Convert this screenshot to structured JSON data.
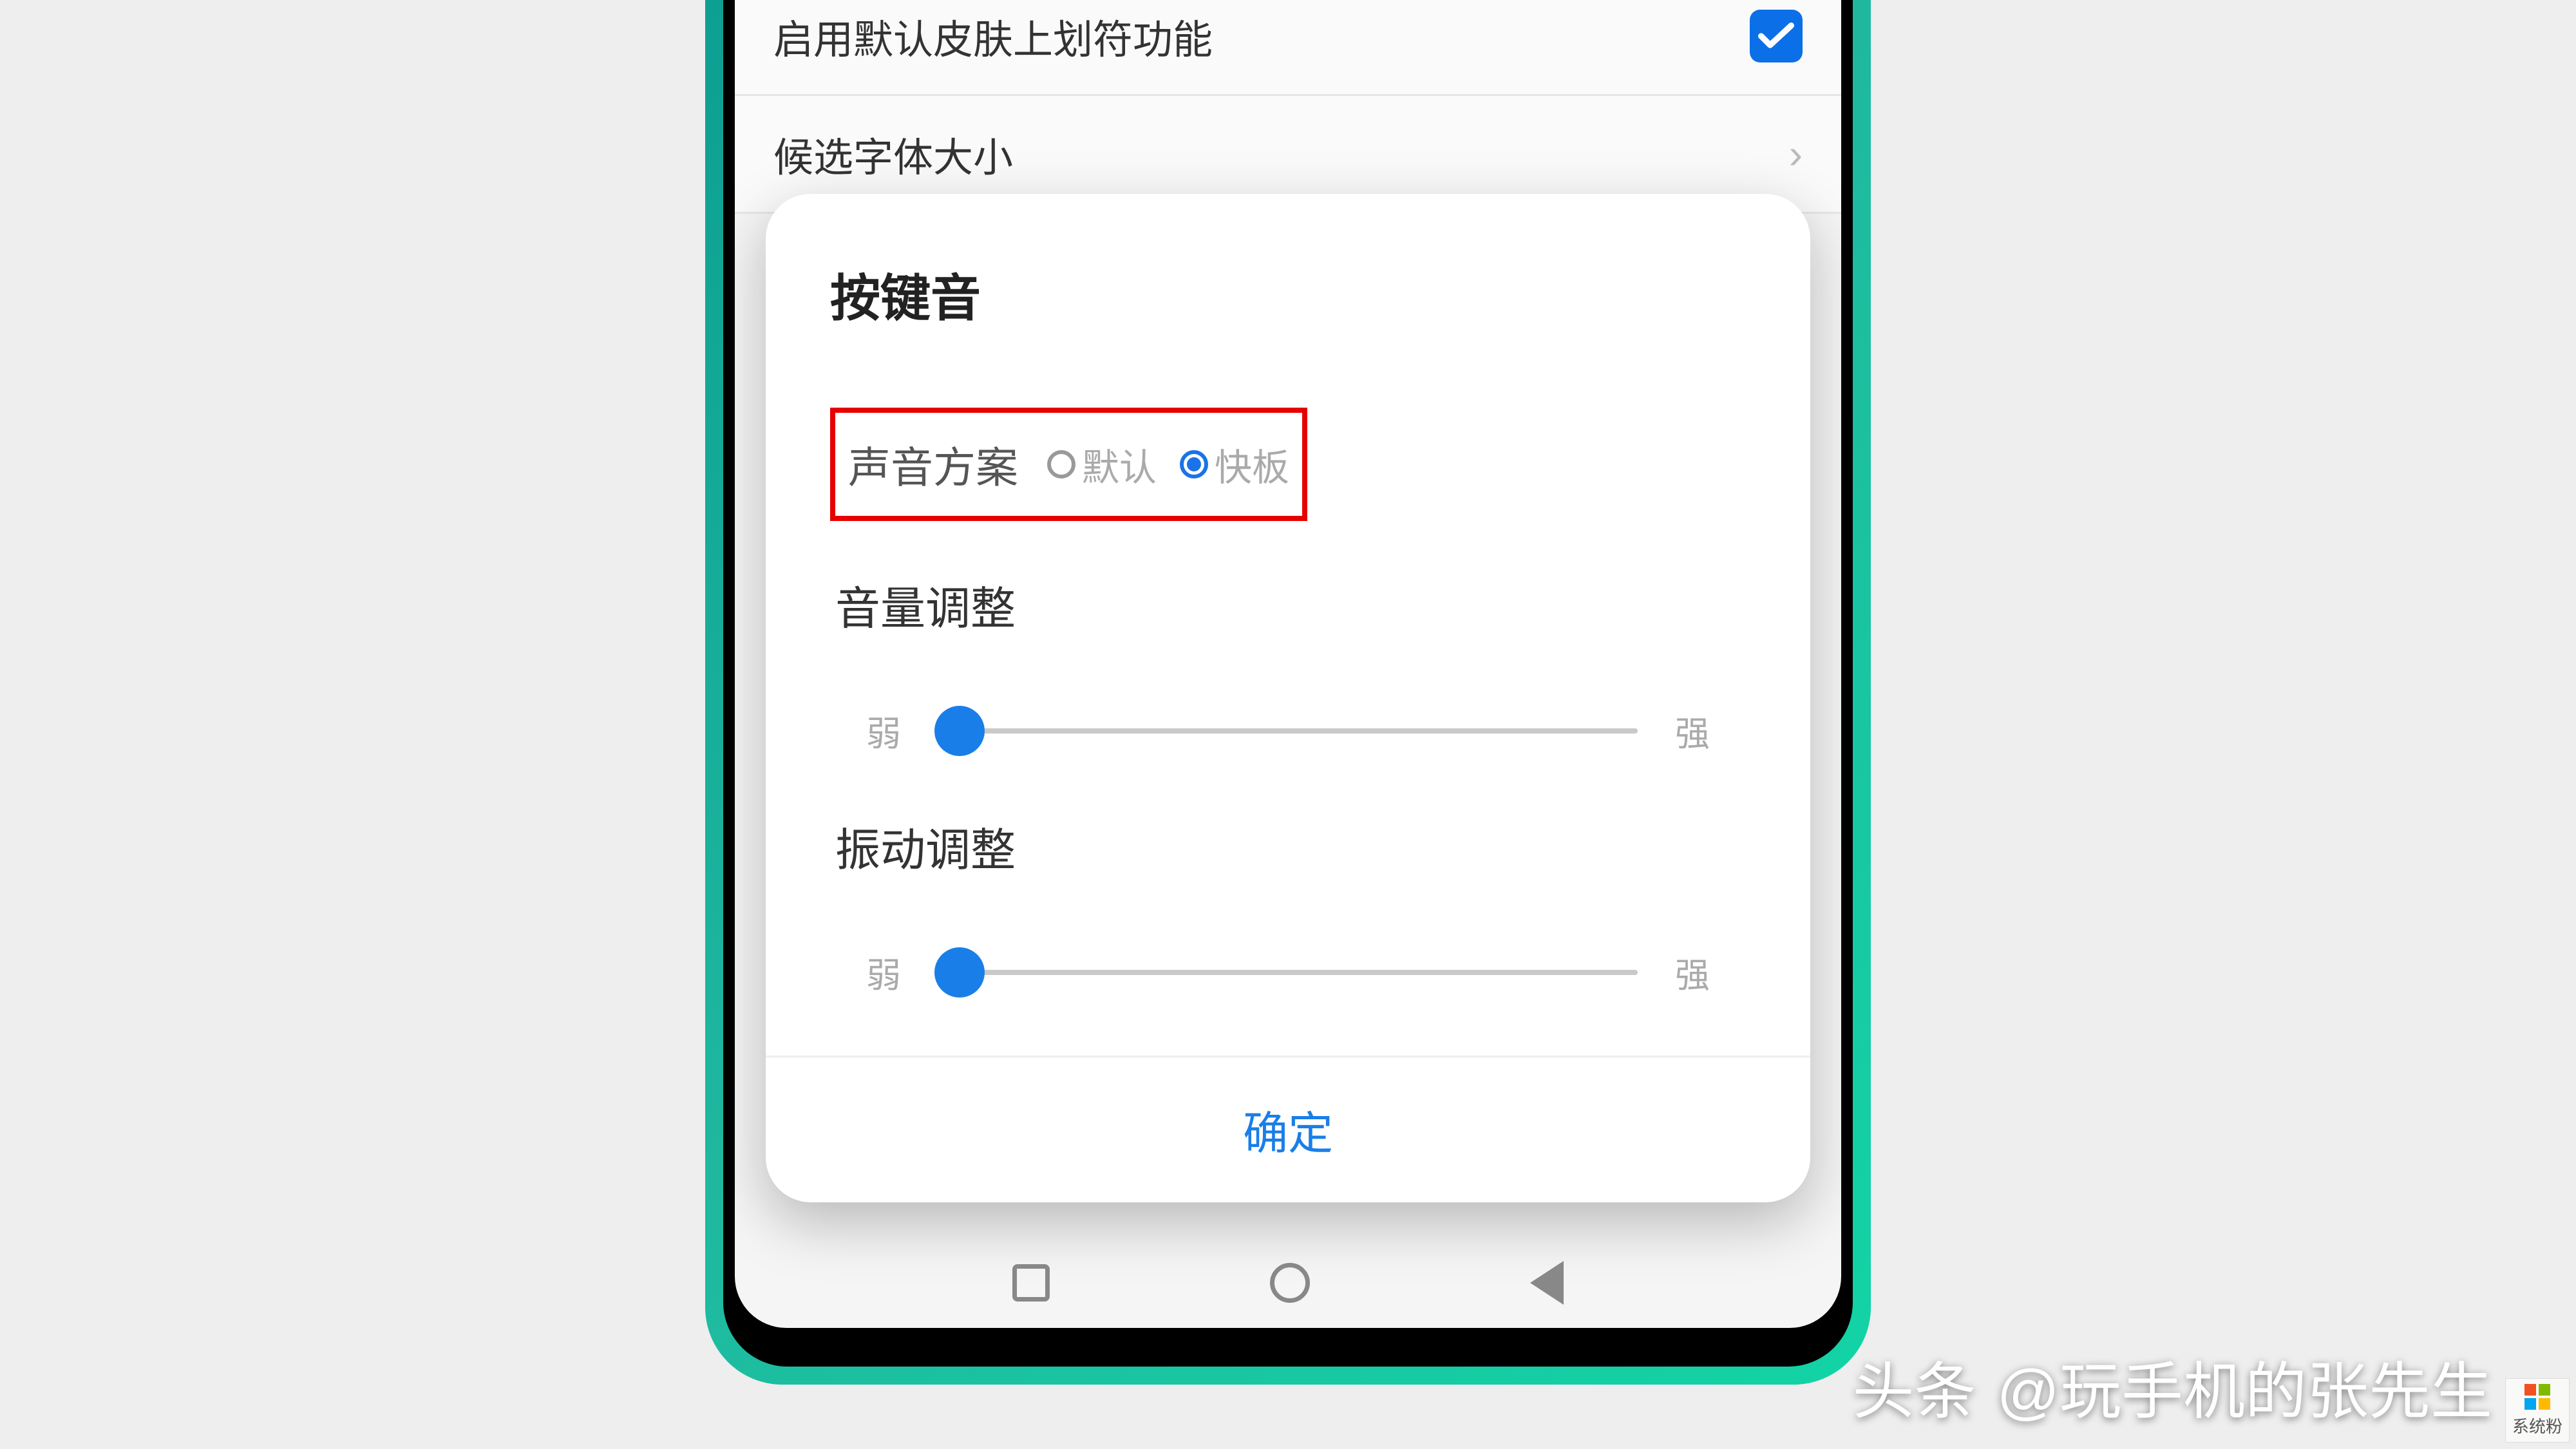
{
  "background": {
    "row1_label": "启用默认皮肤上划符功能",
    "row2_label": "候选字体大小"
  },
  "dialog": {
    "title": "按键音",
    "scheme": {
      "label": "声音方案",
      "options": [
        {
          "label": "默认",
          "selected": false
        },
        {
          "label": "快板",
          "selected": true
        }
      ]
    },
    "volume": {
      "title": "音量调整",
      "low_label": "弱",
      "high_label": "强"
    },
    "vibration": {
      "title": "振动调整",
      "low_label": "弱",
      "high_label": "强"
    },
    "confirm_label": "确定"
  },
  "watermark": {
    "source": "头条",
    "handle": "@玩手机的张先生",
    "corner_logo": "系统粉"
  }
}
